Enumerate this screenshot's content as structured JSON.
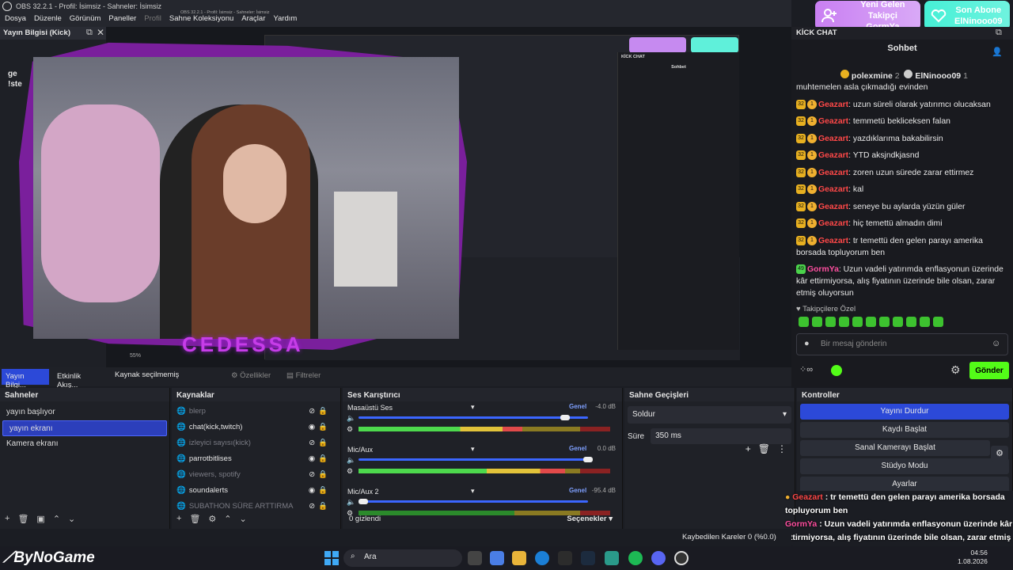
{
  "window": {
    "title": "OBS 32.2.1 - Profil: İsimsiz - Sahneler: İsimsiz"
  },
  "menu": [
    "Dosya",
    "Düzenle",
    "Görünüm",
    "Paneller",
    "Profil",
    "Sahne Koleksiyonu",
    "Araçlar",
    "Yardım"
  ],
  "notifications": {
    "follow_title": "Yeni Gelen Takipçi",
    "follow_name": "GormYa",
    "sub_title": "Son Abone",
    "sub_name": "ElNinooo09"
  },
  "info_dock": {
    "title": "Yayın Bilgisi (Kick)",
    "line1": "ge",
    "line2": "!ste"
  },
  "preview": {
    "nested_title": "OBS 32.2.1 - Profil: İsimsiz - Sahneler: İsimsiz",
    "cam_name": "CEDESSA",
    "zoom": "55%"
  },
  "tabs": {
    "tab1": "Yayın Bilgi...",
    "tab2": "Etkinlik Akış...",
    "no_source": "Kaynak seçilmemiş",
    "props": "Özellikler",
    "filters": "Filtreler"
  },
  "scenes": {
    "title": "Sahneler",
    "items": [
      "yayın başlıyor",
      "yayın ekranı",
      "Kamera ekranı"
    ],
    "selected": 1
  },
  "sources": {
    "title": "Kaynaklar",
    "items": [
      {
        "name": "blerp",
        "visible": false
      },
      {
        "name": "chat(kick,twitch)",
        "visible": true
      },
      {
        "name": "izleyici sayısı(kick)",
        "visible": false
      },
      {
        "name": "parrotbitlises",
        "visible": true
      },
      {
        "name": "viewers, spotify",
        "visible": false
      },
      {
        "name": "soundalerts",
        "visible": true
      },
      {
        "name": "SUBATHON SÜRE ARTTIRMA",
        "visible": false
      }
    ]
  },
  "mixer": {
    "title": "Ses Karıştırıcı",
    "channels": [
      {
        "name": "Masaüstü Ses",
        "tag": "Genel",
        "db": "-4.0 dB",
        "level": 0.65,
        "volume": 0.9
      },
      {
        "name": "Mic/Aux",
        "tag": "Genel",
        "db": "0.0 dB",
        "level": 0.82,
        "volume": 1.0
      },
      {
        "name": "Mic/Aux 2",
        "tag": "Genel",
        "db": "-95.4 dB",
        "level": 0.0,
        "volume": 0.02
      }
    ],
    "ticks": [
      "-60",
      "-54",
      "-48",
      "-42",
      "-36",
      "-30",
      "-24",
      "-18",
      "-12",
      "-6",
      "0"
    ],
    "hidden_count": "0 gizlendi",
    "options": "Seçenekler"
  },
  "transitions": {
    "title": "Sahne Geçişleri",
    "type": "Soldur",
    "duration_label": "Süre",
    "duration": "350 ms"
  },
  "controls": {
    "title": "Kontroller",
    "buttons": [
      "Yayını Durdur",
      "Kaydı Başlat",
      "Sanal Kamerayı Başlat",
      "Stüdyo Modu",
      "Ayarlar"
    ]
  },
  "chat": {
    "dock_title": "KİCK CHAT",
    "header": "Sohbet",
    "pinned_user1": "polexmine",
    "pinned_count1": "2",
    "pinned_user2": "ElNinooo09",
    "pinned_count2": "1",
    "messages": [
      {
        "user": "",
        "text": "muhtemelen asla çıkmadığı evinden",
        "badge": "",
        "color": "#e8e8e8"
      },
      {
        "user": "Geazart",
        "text": "uzun süreli olarak yatırımcı olucaksan",
        "badge": "32",
        "color": "#ff4848"
      },
      {
        "user": "Geazart",
        "text": "temmetü bekliceksen falan",
        "badge": "32",
        "color": "#ff4848"
      },
      {
        "user": "Geazart",
        "text": "yazdıklarıma bakabilirsin",
        "badge": "32",
        "color": "#ff4848"
      },
      {
        "user": "Geazart",
        "text": "YTD aksjndkjasnd",
        "badge": "32",
        "color": "#ff4848"
      },
      {
        "user": "Geazart",
        "text": "zoren uzun sürede zarar ettirmez",
        "badge": "32",
        "color": "#ff4848"
      },
      {
        "user": "Geazart",
        "text": "kal",
        "badge": "32",
        "color": "#ff4848"
      },
      {
        "user": "Geazart",
        "text": "seneye bu aylarda yüzün güler",
        "badge": "32",
        "color": "#ff4848"
      },
      {
        "user": "Geazart",
        "text": "hiç temettü almadın dimi",
        "badge": "32",
        "color": "#ff4848"
      },
      {
        "user": "Geazart",
        "text": "tr temettü den gelen parayı amerika borsada topluyorum ben",
        "badge": "32",
        "color": "#ff4848"
      },
      {
        "user": "GormYa",
        "text": "Uzun vadeli yatırımda enflasyonun üzerinde kâr ettirmiyorsa, alış fiyatının üzerinde bile olsan, zarar etmiş oluyorsun",
        "badge": "49",
        "color": "#ff4fa0"
      }
    ],
    "follower_only": "Takipçilere Özel",
    "input_placeholder": "Bir mesaj gönderin",
    "send": "Gönder"
  },
  "overlay": {
    "line1_user": "Geazart",
    "line1_text": "tr temettü den gelen parayı amerika borsada topluyorum ben",
    "line2_user": "GormYa",
    "line2_text": "Uzun vadeli yatırımda enflasyonun üzerinde kâr ettirmiyorsa, alış fiyatının üzerinde bile olsan, zarar etmiş oluyorsun"
  },
  "status": {
    "dropped": "Kaybedilen Kareler 0 (%0.0)"
  },
  "taskbar": {
    "brand": "ByNoGame",
    "search": "Ara",
    "time": "04:56",
    "date": "1.08.2026"
  }
}
